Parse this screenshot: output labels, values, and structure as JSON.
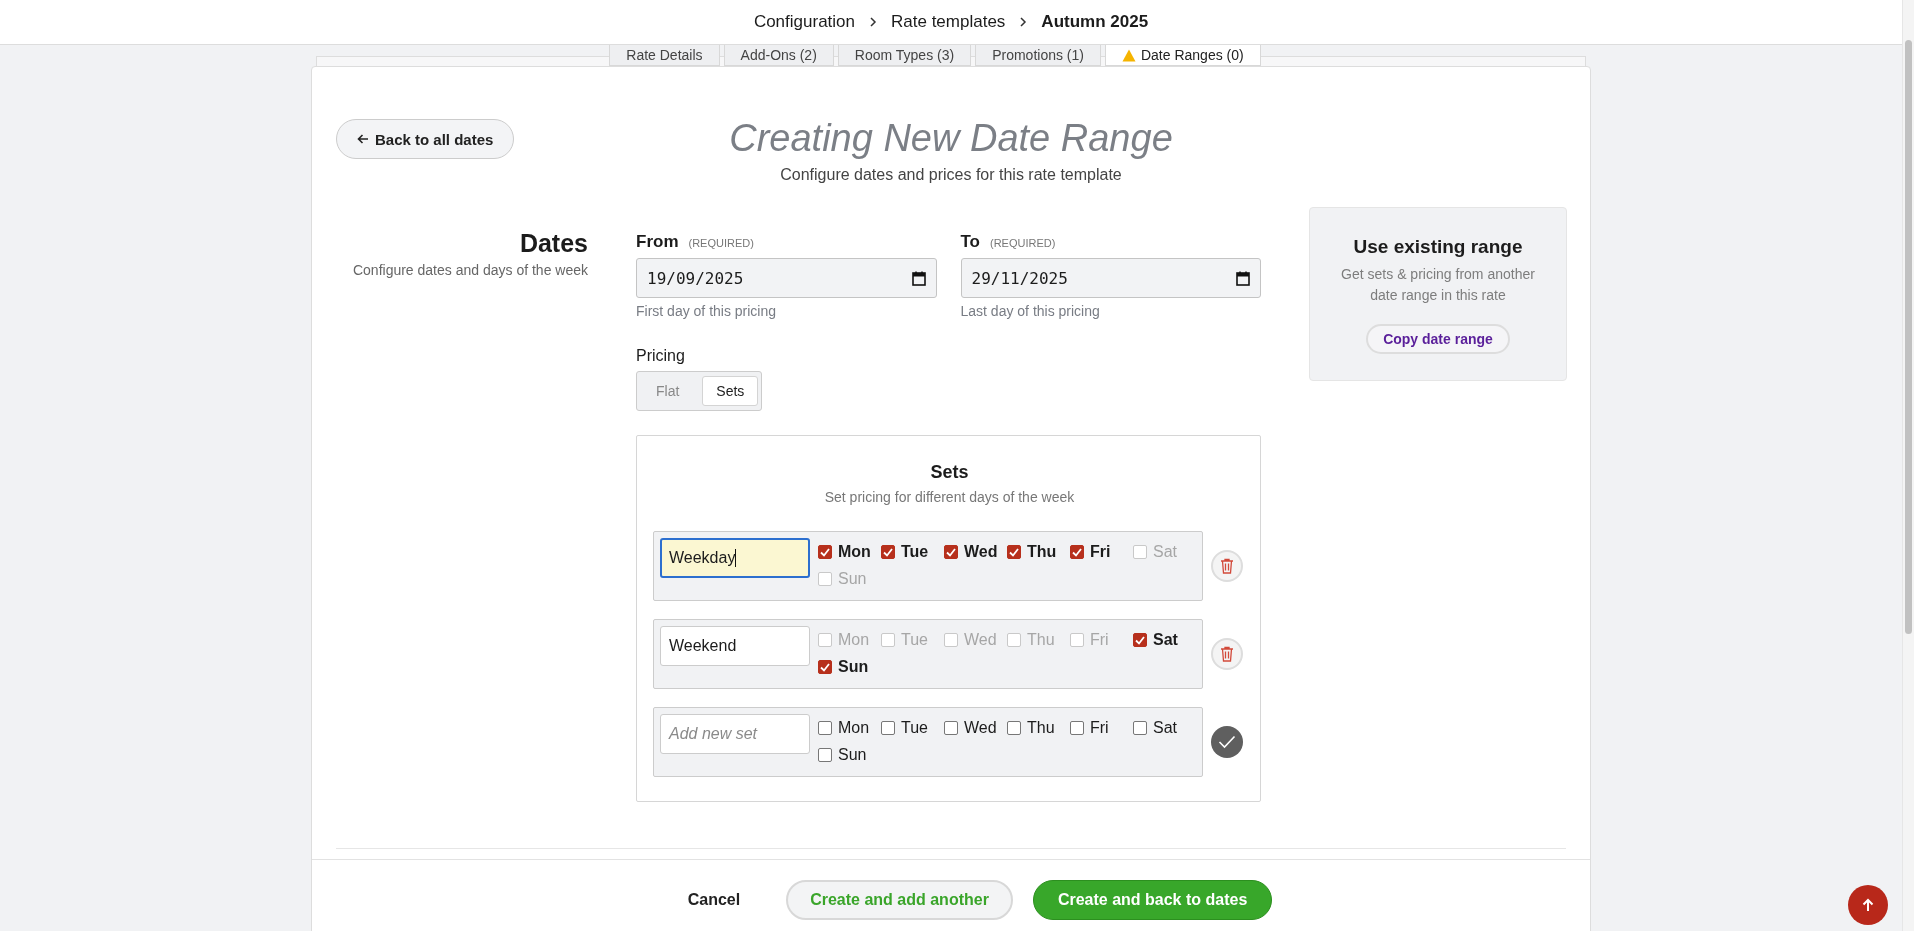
{
  "breadcrumb": [
    {
      "label": "Configuration",
      "current": false
    },
    {
      "label": "Rate templates",
      "current": false
    },
    {
      "label": "Autumn 2025",
      "current": true
    }
  ],
  "tabs": [
    {
      "label": "Rate Details",
      "selected": false,
      "warning": false
    },
    {
      "label": "Add-Ons (2)",
      "selected": false,
      "warning": false
    },
    {
      "label": "Room Types (3)",
      "selected": false,
      "warning": false
    },
    {
      "label": "Promotions (1)",
      "selected": false,
      "warning": false
    },
    {
      "label": "Date Ranges (0)",
      "selected": true,
      "warning": true
    }
  ],
  "back_button": "Back to all dates",
  "title": "Creating New Date Range",
  "subtitle": "Configure dates and prices for this rate template",
  "dates_section": {
    "heading": "Dates",
    "description": "Configure dates and days of the week"
  },
  "date_fields": [
    {
      "label": "From",
      "required": "(REQUIRED)",
      "value": "19/09/2025",
      "hint": "First day of this pricing"
    },
    {
      "label": "To",
      "required": "(REQUIRED)",
      "value": "29/11/2025",
      "hint": "Last day of this pricing"
    }
  ],
  "pricing": {
    "label": "Pricing",
    "options": [
      {
        "label": "Flat",
        "selected": false
      },
      {
        "label": "Sets",
        "selected": true
      }
    ]
  },
  "sets": {
    "title": "Sets",
    "subtitle": "Set pricing for different days of the week",
    "rows": [
      {
        "kind": "existing",
        "value": "Weekday",
        "focused": true,
        "days": [
          {
            "label": "Mon",
            "checked": true
          },
          {
            "label": "Tue",
            "checked": true
          },
          {
            "label": "Wed",
            "checked": true
          },
          {
            "label": "Thu",
            "checked": true
          },
          {
            "label": "Fri",
            "checked": true
          },
          {
            "label": "Sat",
            "checked": false
          },
          {
            "label": "Sun",
            "checked": false
          }
        ]
      },
      {
        "kind": "existing",
        "value": "Weekend",
        "focused": false,
        "days": [
          {
            "label": "Mon",
            "checked": false
          },
          {
            "label": "Tue",
            "checked": false
          },
          {
            "label": "Wed",
            "checked": false
          },
          {
            "label": "Thu",
            "checked": false
          },
          {
            "label": "Fri",
            "checked": false
          },
          {
            "label": "Sat",
            "checked": true
          },
          {
            "label": "Sun",
            "checked": true
          }
        ]
      },
      {
        "kind": "new",
        "placeholder": "Add new set",
        "focused": false,
        "days": [
          {
            "label": "Mon",
            "checked": false
          },
          {
            "label": "Tue",
            "checked": false
          },
          {
            "label": "Wed",
            "checked": false
          },
          {
            "label": "Thu",
            "checked": false
          },
          {
            "label": "Fri",
            "checked": false
          },
          {
            "label": "Sat",
            "checked": false
          },
          {
            "label": "Sun",
            "checked": false
          }
        ]
      }
    ]
  },
  "use_existing": {
    "title": "Use existing range",
    "text": "Get sets & pricing from another date range in this rate",
    "button": "Copy date range"
  },
  "footer": {
    "cancel": "Cancel",
    "secondary": "Create and add another",
    "primary": "Create and back to dates"
  }
}
